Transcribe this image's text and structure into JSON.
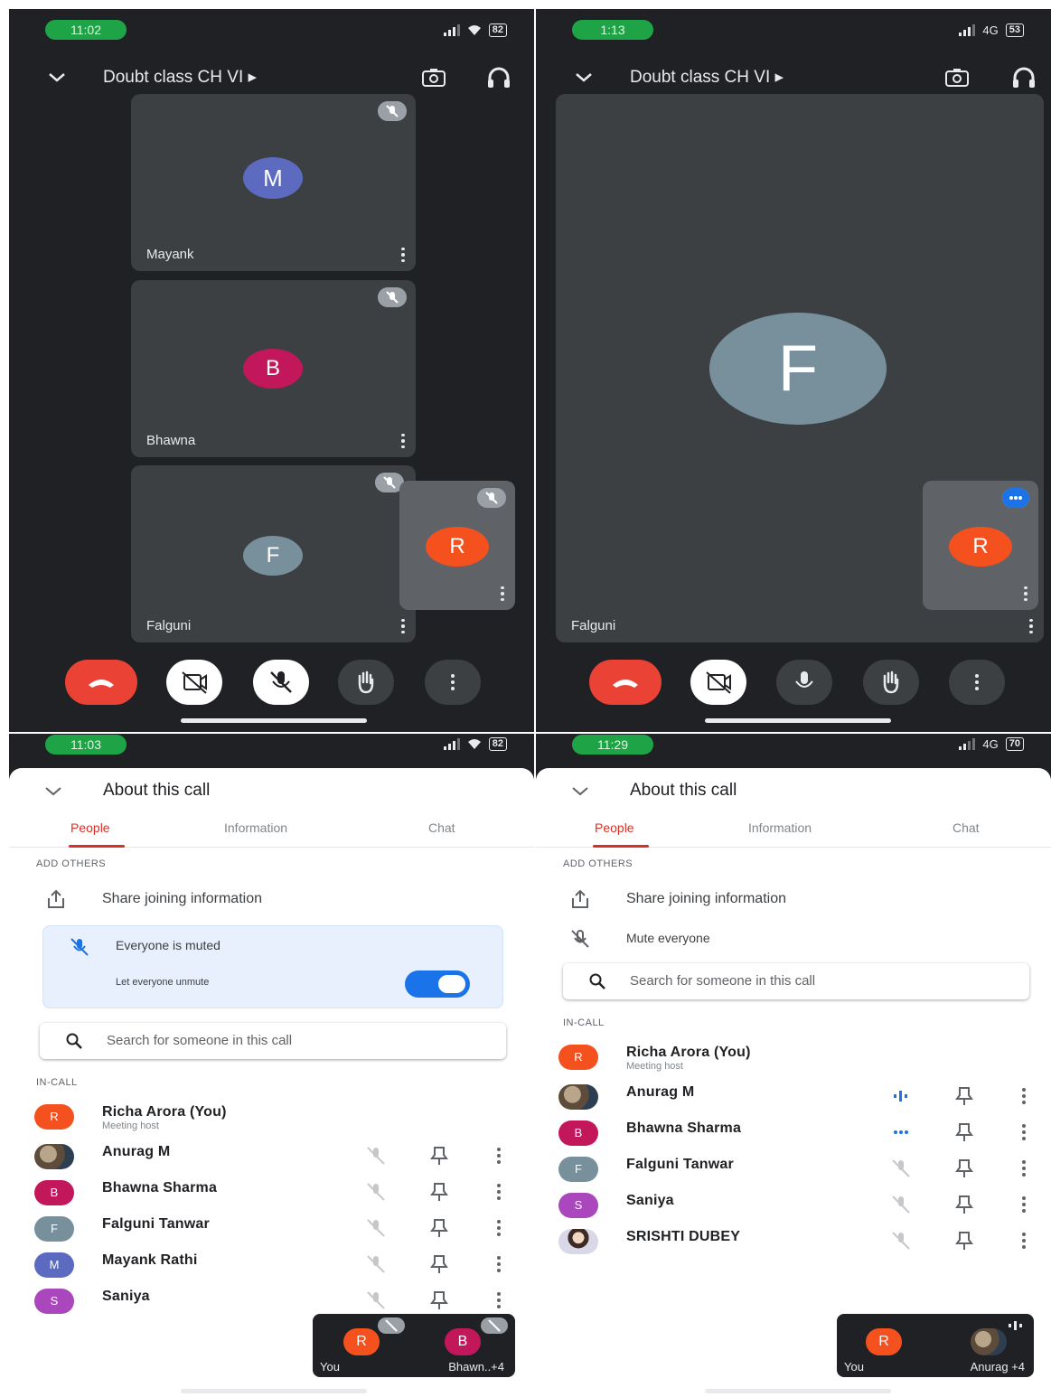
{
  "p1": {
    "time": "11:02",
    "battery": "82",
    "meeting_title": "Doubt class CH VI ▸",
    "tiles": [
      {
        "initial": "M",
        "name": "Mayank"
      },
      {
        "initial": "B",
        "name": "Bhawna"
      },
      {
        "initial": "F",
        "name": "Falguni"
      }
    ],
    "self_initial": "R"
  },
  "p2": {
    "time": "1:13",
    "network": "4G",
    "battery": "53",
    "meeting_title": "Doubt class CH VI ▸",
    "main_initial": "F",
    "main_name": "Falguni",
    "self_initial": "R"
  },
  "p3": {
    "time": "11:03",
    "battery": "82",
    "title": "About this call",
    "tabs": [
      "People",
      "Information",
      "Chat"
    ],
    "add_others": "ADD OTHERS",
    "share": "Share joining information",
    "everyone_muted": "Everyone is muted",
    "let_unmute": "Let everyone unmute",
    "search_placeholder": "Search for someone in this call",
    "in_call": "IN-CALL",
    "people": [
      {
        "initial": "R",
        "name": "Richa Arora (You)",
        "sub": "Meeting host"
      },
      {
        "initial": "",
        "name": "Anurag M"
      },
      {
        "initial": "B",
        "name": "Bhawna Sharma"
      },
      {
        "initial": "F",
        "name": "Falguni Tanwar"
      },
      {
        "initial": "M",
        "name": "Mayank Rathi"
      },
      {
        "initial": "S",
        "name": "Saniya"
      }
    ],
    "tray": {
      "you_initial": "R",
      "you_label": "You",
      "other_initial": "B",
      "other_label": "Bhawn..+4"
    }
  },
  "p4": {
    "time": "11:29",
    "network": "4G",
    "battery": "70",
    "title": "About this call",
    "tabs": [
      "People",
      "Information",
      "Chat"
    ],
    "add_others": "ADD OTHERS",
    "share": "Share joining information",
    "mute_everyone": "Mute everyone",
    "search_placeholder": "Search for someone in this call",
    "in_call": "IN-CALL",
    "people": [
      {
        "initial": "R",
        "name": "Richa Arora (You)",
        "sub": "Meeting host"
      },
      {
        "initial": "",
        "name": "Anurag M"
      },
      {
        "initial": "B",
        "name": "Bhawna Sharma"
      },
      {
        "initial": "F",
        "name": "Falguni Tanwar"
      },
      {
        "initial": "S",
        "name": "Saniya"
      },
      {
        "initial": "",
        "name": "SRISHTI DUBEY"
      }
    ],
    "tray": {
      "you_initial": "R",
      "you_label": "You",
      "other_label": "Anurag +4"
    }
  },
  "colors": {
    "end_call_red": "#ea4335",
    "avatar_purple": "#5c6bc0",
    "avatar_pink": "#c2185b",
    "avatar_slate": "#78909c",
    "avatar_orange": "#f4511e",
    "avatar_violet": "#ab47bc",
    "accent_red": "#d93025",
    "accent_blue": "#1a73e8"
  }
}
